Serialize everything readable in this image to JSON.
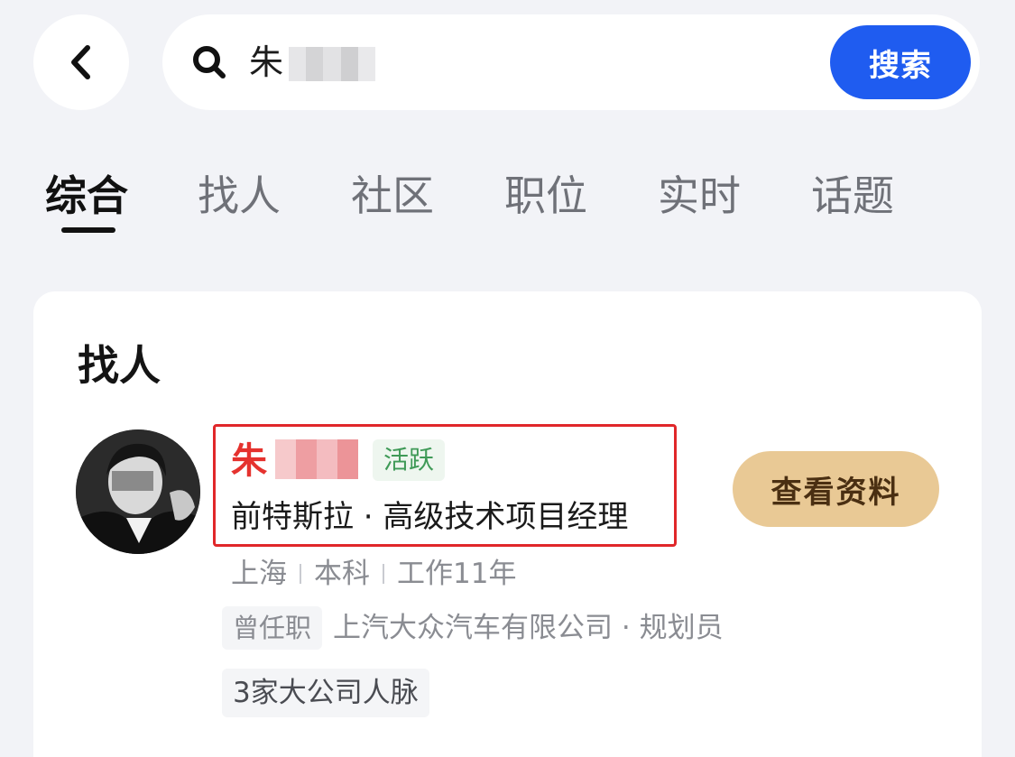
{
  "search": {
    "query_visible": "朱",
    "button_label": "搜索"
  },
  "tabs": [
    {
      "label": "综合",
      "active": true
    },
    {
      "label": "找人",
      "active": false
    },
    {
      "label": "社区",
      "active": false
    },
    {
      "label": "职位",
      "active": false
    },
    {
      "label": "实时",
      "active": false
    },
    {
      "label": "话题",
      "active": false
    }
  ],
  "card": {
    "title": "找人",
    "person": {
      "name_visible": "朱",
      "status_badge": "活跃",
      "headline": "前特斯拉 · 高级技术项目经理",
      "location": "上海",
      "education": "本科",
      "experience": "工作11年",
      "previous_label": "曾任职",
      "previous_position": "上汽大众汽车有限公司 · 规划员",
      "network": "3家大公司人脉",
      "view_button": "查看资料"
    }
  },
  "colors": {
    "primary_blue": "#1f5cf0",
    "name_red": "#e5322e",
    "active_green": "#3f9a57",
    "view_button_bg": "#e9c995",
    "highlight_border": "#e0272a"
  },
  "icons": {
    "back": "chevron-left-icon",
    "search": "search-icon"
  }
}
